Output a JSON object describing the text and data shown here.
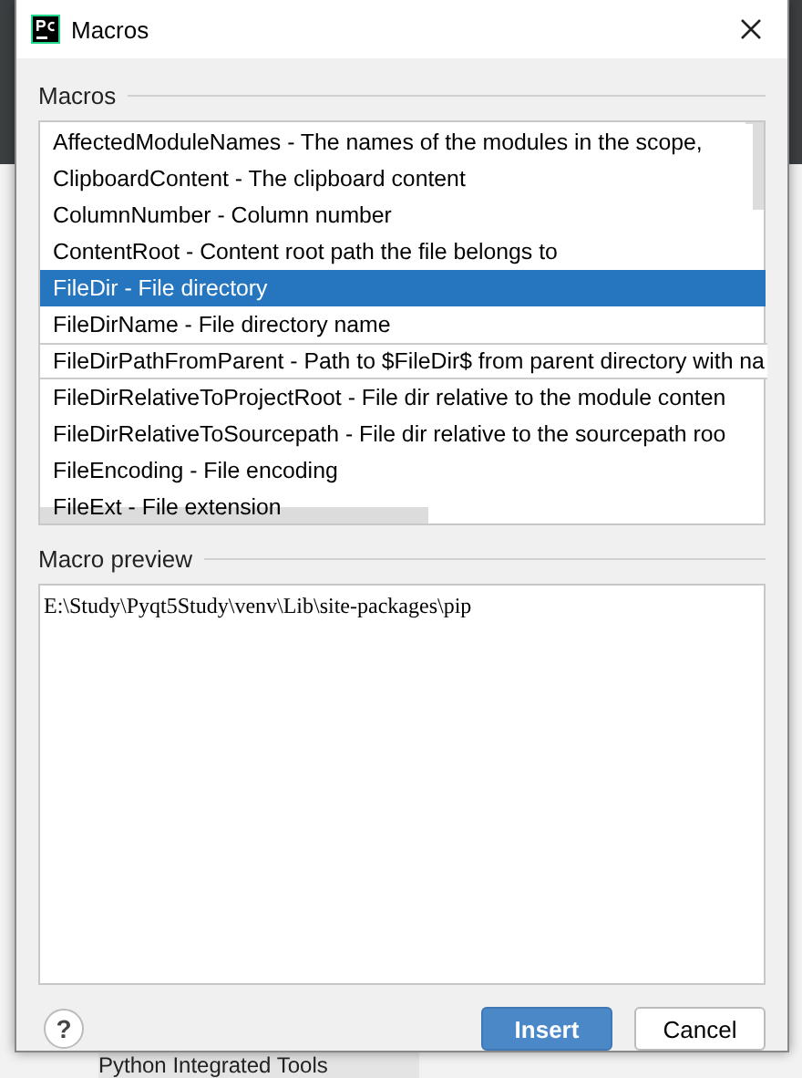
{
  "background": {
    "bottom_item": "Python Integrated Tools"
  },
  "window": {
    "title": "Macros"
  },
  "macros": {
    "label": "Macros",
    "items": [
      {
        "text": "AffectedModuleNames - The names of the modules in the scope,",
        "selected": false
      },
      {
        "text": "ClipboardContent - The clipboard content",
        "selected": false
      },
      {
        "text": "ColumnNumber - Column number",
        "selected": false
      },
      {
        "text": "ContentRoot - Content root path the file belongs to",
        "selected": false
      },
      {
        "text": "FileDir - File directory",
        "selected": true
      },
      {
        "text": "FileDirName - File directory name",
        "selected": false
      },
      {
        "text": "FileDirPathFromParent - Path to $FileDir$ from parent directory with na",
        "selected": false,
        "expanded": true
      },
      {
        "text": "FileDirRelativeToProjectRoot - File dir relative to the module conten",
        "selected": false
      },
      {
        "text": "FileDirRelativeToSourcepath - File dir relative to the sourcepath roo",
        "selected": false
      },
      {
        "text": "FileEncoding - File encoding",
        "selected": false
      },
      {
        "text": "FileExt - File extension",
        "selected": false
      }
    ]
  },
  "preview": {
    "label": "Macro preview",
    "value": "E:\\Study\\Pyqt5Study\\venv\\Lib\\site-packages\\pip"
  },
  "buttons": [
    {
      "kind": "help",
      "label": "?"
    },
    {
      "kind": "primary",
      "label": "Insert"
    },
    {
      "kind": "normal",
      "label": "Cancel"
    }
  ]
}
